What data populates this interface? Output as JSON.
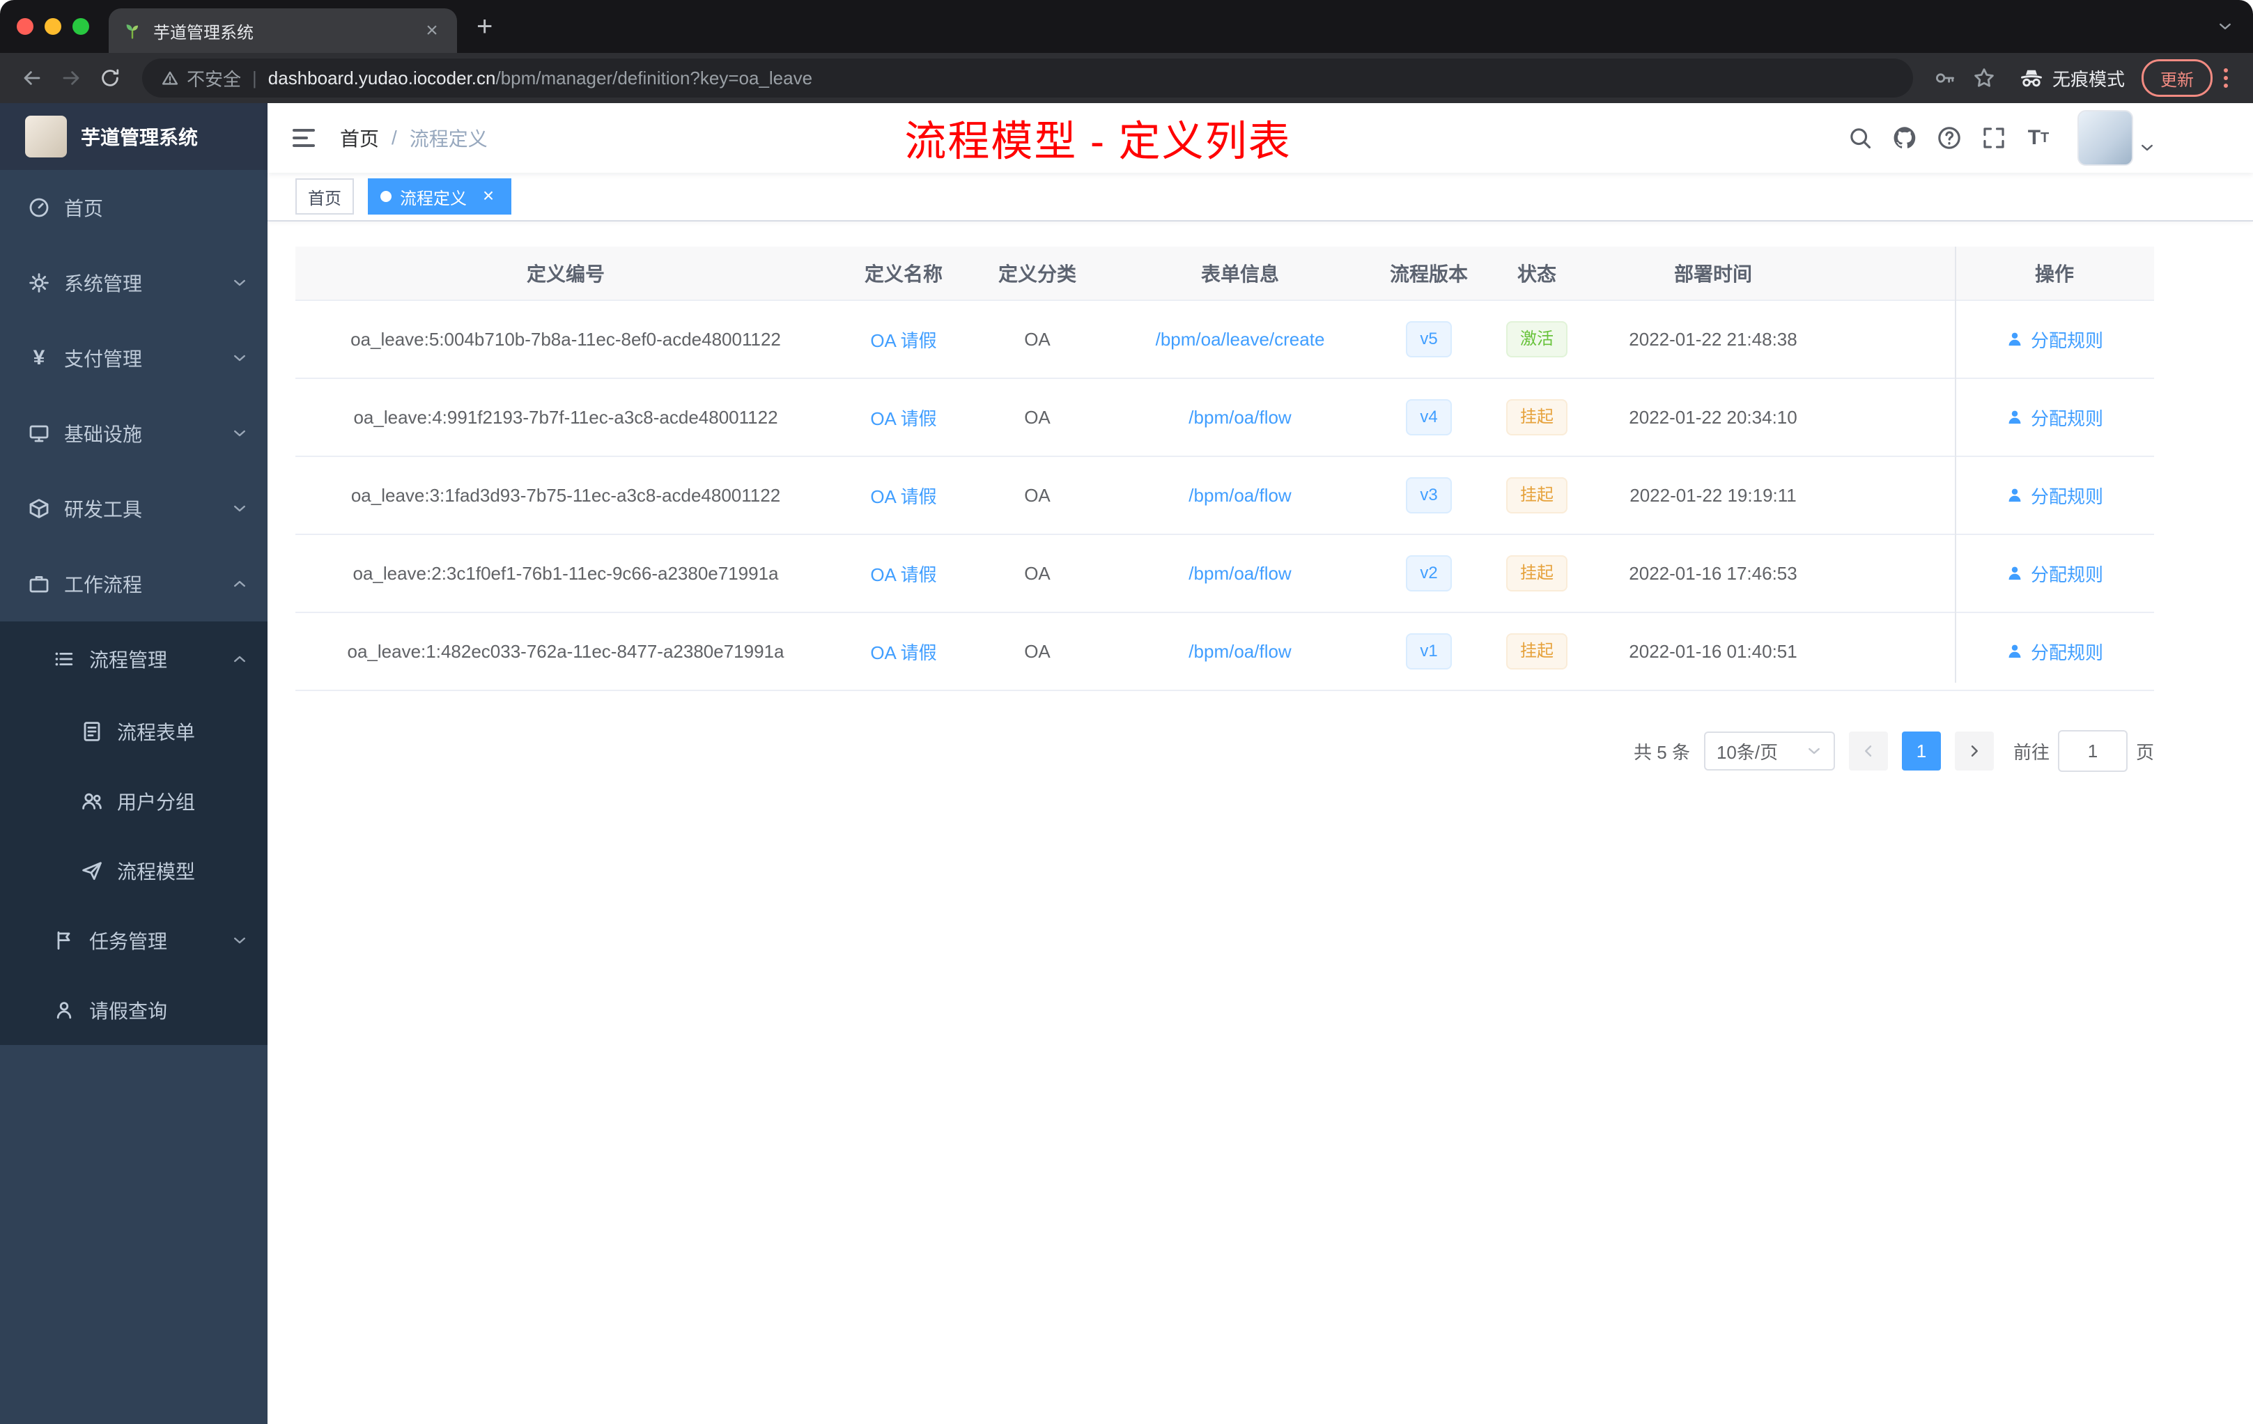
{
  "browser": {
    "tab_title": "芋道管理系统",
    "new_tab_button": "+",
    "security_label": "不安全",
    "url_domain": "dashboard.yudao.iocoder.cn",
    "url_path": "/bpm/manager/definition?key=oa_leave",
    "incognito_label": "无痕模式",
    "update_label": "更新"
  },
  "sidebar": {
    "title": "芋道管理系统",
    "items": [
      {
        "label": "首页",
        "icon": "dashboard-icon",
        "level": 1
      },
      {
        "label": "系统管理",
        "icon": "gear-icon",
        "level": 1,
        "chevron": "down"
      },
      {
        "label": "支付管理",
        "icon": "yen-icon",
        "level": 1,
        "chevron": "down"
      },
      {
        "label": "基础设施",
        "icon": "monitor-icon",
        "level": 1,
        "chevron": "down"
      },
      {
        "label": "研发工具",
        "icon": "toolbox-icon",
        "level": 1,
        "chevron": "down"
      },
      {
        "label": "工作流程",
        "icon": "briefcase-icon",
        "level": 1,
        "chevron": "up"
      },
      {
        "label": "流程管理",
        "icon": "list-icon",
        "level": 2,
        "chevron": "up"
      },
      {
        "label": "流程表单",
        "icon": "document-icon",
        "level": 3
      },
      {
        "label": "用户分组",
        "icon": "users-icon",
        "level": 3
      },
      {
        "label": "流程模型",
        "icon": "paper-plane-icon",
        "level": 3
      },
      {
        "label": "任务管理",
        "icon": "flag-icon",
        "level": 2,
        "chevron": "down"
      },
      {
        "label": "请假查询",
        "icon": "person-icon",
        "level": 2
      }
    ]
  },
  "header": {
    "breadcrumb": {
      "home": "首页",
      "separator": "/",
      "current": "流程定义"
    },
    "annotation": "流程模型 - 定义列表"
  },
  "tags": {
    "items": [
      {
        "label": "首页",
        "active": false
      },
      {
        "label": "流程定义",
        "active": true
      }
    ]
  },
  "table": {
    "columns": [
      "定义编号",
      "定义名称",
      "定义分类",
      "表单信息",
      "流程版本",
      "状态",
      "部署时间",
      "操作"
    ],
    "rows": [
      {
        "id": "oa_leave:5:004b710b-7b8a-11ec-8ef0-acde48001122",
        "name": "OA 请假",
        "category": "OA",
        "form": "/bpm/oa/leave/create",
        "version": "v5",
        "status": "激活",
        "status_type": "success",
        "deployed_at": "2022-01-22 21:48:38",
        "action": "分配规则"
      },
      {
        "id": "oa_leave:4:991f2193-7b7f-11ec-a3c8-acde48001122",
        "name": "OA 请假",
        "category": "OA",
        "form": "/bpm/oa/flow",
        "version": "v4",
        "status": "挂起",
        "status_type": "warning",
        "deployed_at": "2022-01-22 20:34:10",
        "action": "分配规则"
      },
      {
        "id": "oa_leave:3:1fad3d93-7b75-11ec-a3c8-acde48001122",
        "name": "OA 请假",
        "category": "OA",
        "form": "/bpm/oa/flow",
        "version": "v3",
        "status": "挂起",
        "status_type": "warning",
        "deployed_at": "2022-01-22 19:19:11",
        "action": "分配规则"
      },
      {
        "id": "oa_leave:2:3c1f0ef1-76b1-11ec-9c66-a2380e71991a",
        "name": "OA 请假",
        "category": "OA",
        "form": "/bpm/oa/flow",
        "version": "v2",
        "status": "挂起",
        "status_type": "warning",
        "deployed_at": "2022-01-16 17:46:53",
        "action": "分配规则"
      },
      {
        "id": "oa_leave:1:482ec033-762a-11ec-8477-a2380e71991a",
        "name": "OA 请假",
        "category": "OA",
        "form": "/bpm/oa/flow",
        "version": "v1",
        "status": "挂起",
        "status_type": "warning",
        "deployed_at": "2022-01-16 01:40:51",
        "action": "分配规则"
      }
    ]
  },
  "pagination": {
    "total": "共 5 条",
    "page_size": "10条/页",
    "current_page": "1",
    "goto_label": "前往",
    "goto_value": "1",
    "page_unit": "页"
  },
  "colors": {
    "accent": "#409EFF",
    "success": "#67C23A",
    "warning": "#E6A23C",
    "sidebar_bg": "#304156",
    "submenu_bg": "#1F2D3D",
    "annotation": "#FF0000"
  }
}
